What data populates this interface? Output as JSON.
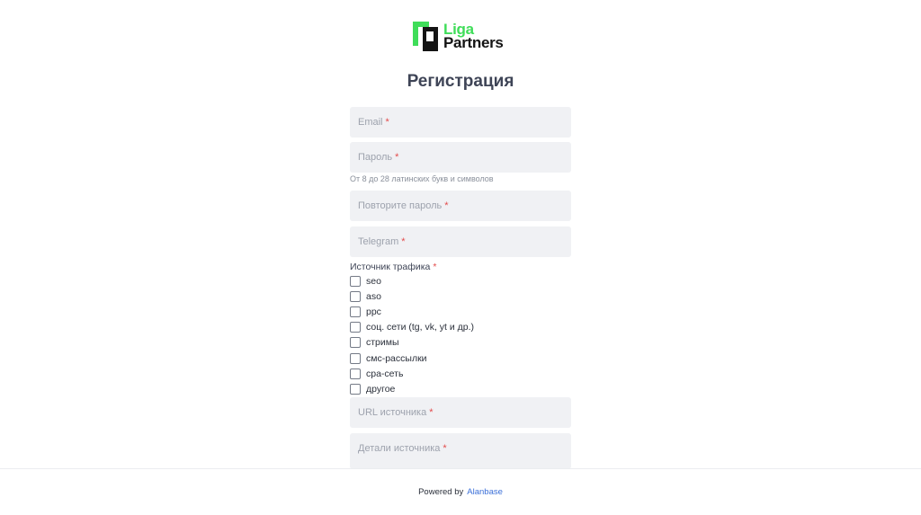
{
  "brand": {
    "line1": "Liga",
    "line2": "Partners",
    "color": "#3fdd59"
  },
  "page": {
    "title": "Регистрация"
  },
  "form": {
    "email_placeholder": "Email",
    "password_placeholder": "Пароль",
    "password_hint": "От 8 до 28 латинских букв и символов",
    "repeat_password_placeholder": "Повторите пароль",
    "telegram_placeholder": "Telegram",
    "traffic_source_label": "Источник трафика",
    "traffic_sources": [
      {
        "label": "seo",
        "checked": false
      },
      {
        "label": "aso",
        "checked": false
      },
      {
        "label": "ppc",
        "checked": false
      },
      {
        "label": "соц. сети (tg, vk, yt и др.)",
        "checked": false
      },
      {
        "label": "стримы",
        "checked": false
      },
      {
        "label": "смс-рассылки",
        "checked": false
      },
      {
        "label": "cpa-сеть",
        "checked": false
      },
      {
        "label": "другое",
        "checked": false
      }
    ],
    "url_source_placeholder": "URL источника",
    "source_details_placeholder": "Детали источника",
    "required_mark": "*"
  },
  "footer": {
    "powered_by": "Powered by",
    "link": "Alanbase"
  }
}
